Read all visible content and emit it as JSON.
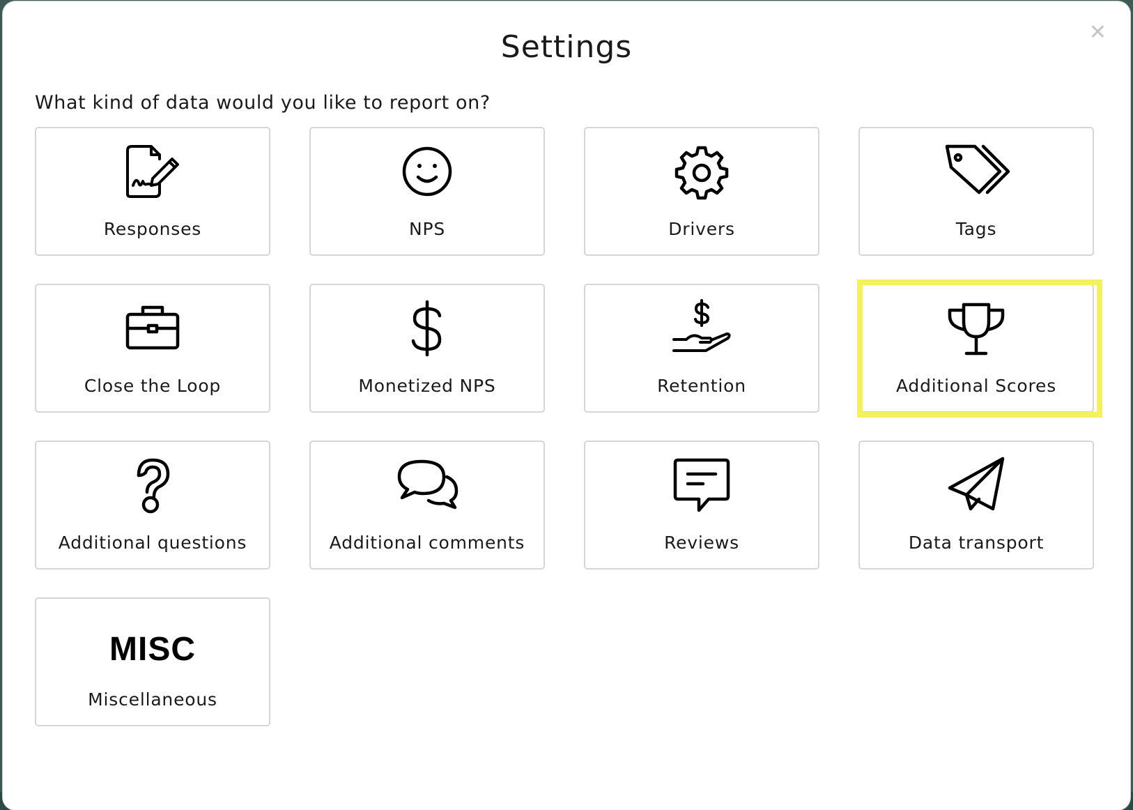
{
  "dialog": {
    "title": "Settings",
    "close_icon": "close-icon",
    "question": "What kind of data would you like to report on?"
  },
  "options": [
    {
      "label": "Responses",
      "icon": "signed-document-icon"
    },
    {
      "label": "NPS",
      "icon": "smiley-icon"
    },
    {
      "label": "Drivers",
      "icon": "gear-icon"
    },
    {
      "label": "Tags",
      "icon": "tags-icon"
    },
    {
      "label": "Close the Loop",
      "icon": "briefcase-icon"
    },
    {
      "label": "Monetized NPS",
      "icon": "dollar-icon"
    },
    {
      "label": "Retention",
      "icon": "hand-dollar-icon"
    },
    {
      "label": "Additional Scores",
      "icon": "trophy-icon",
      "highlighted": true
    },
    {
      "label": "Additional questions",
      "icon": "question-icon"
    },
    {
      "label": "Additional comments",
      "icon": "chat-bubbles-icon"
    },
    {
      "label": "Reviews",
      "icon": "message-icon"
    },
    {
      "label": "Data transport",
      "icon": "paper-plane-icon"
    },
    {
      "label": "Miscellaneous",
      "icon": "misc-text-icon",
      "icon_text": "MISC"
    }
  ],
  "colors": {
    "highlight": "#f4f159",
    "tile_border": "#d6d6d6",
    "close": "#c4c4c4"
  }
}
